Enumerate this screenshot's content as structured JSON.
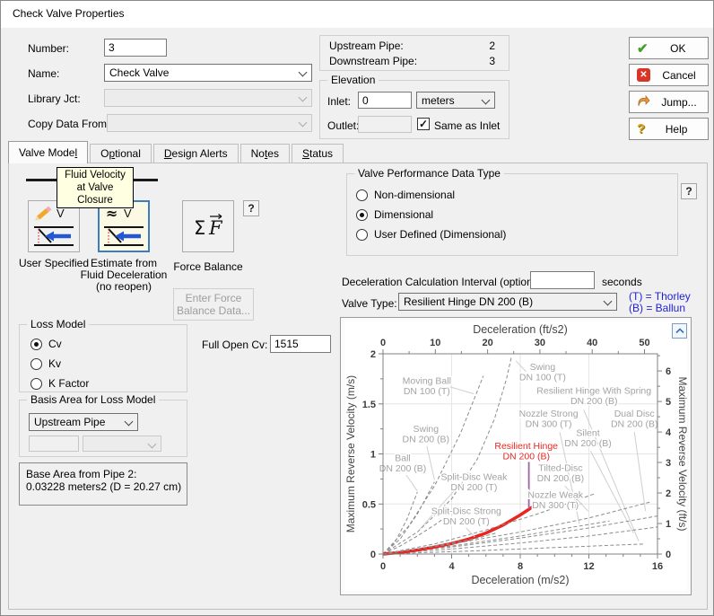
{
  "window": {
    "title": "Check Valve Properties"
  },
  "header": {
    "number_label": "Number:",
    "number_value": "3",
    "name_label": "Name:",
    "name_value": "Check Valve",
    "library_label": "Library Jct:",
    "library_value": "",
    "copy_label": "Copy Data From Jct...",
    "copy_value": "",
    "upstream_label": "Upstream Pipe:",
    "upstream_value": "2",
    "downstream_label": "Downstream Pipe:",
    "downstream_value": "3",
    "elevation": {
      "group_label": "Elevation",
      "inlet_label": "Inlet:",
      "inlet_value": "0",
      "inlet_unit": "meters",
      "outlet_label": "Outlet:",
      "outlet_value": "",
      "same_as_inlet_label": "Same as Inlet",
      "same_as_inlet_checked": true
    }
  },
  "action_buttons": {
    "ok": "OK",
    "cancel": "Cancel",
    "jump": "Jump...",
    "help": "Help"
  },
  "tabs": [
    {
      "label": "Valve Model",
      "accel": 10,
      "active": true
    },
    {
      "label": "Optional",
      "accel": 1
    },
    {
      "label": "Design Alerts",
      "accel": 0
    },
    {
      "label": "Notes",
      "accel": 2
    },
    {
      "label": "Status",
      "accel": 0
    }
  ],
  "valve_model_tab": {
    "tooltip": {
      "line1": "Fluid Velocity",
      "line2": "at Valve Closure"
    },
    "model_buttons": [
      {
        "label_lines": [
          "User Specified"
        ],
        "selected": false
      },
      {
        "label_lines": [
          "Estimate from",
          "Fluid Deceleration",
          "(no reopen)"
        ],
        "selected": true
      },
      {
        "label_lines": [
          "Force Balance"
        ],
        "selected": false
      }
    ],
    "help_button": "?",
    "enter_force_balance_lines": [
      "Enter Force",
      "Balance Data..."
    ],
    "loss_model": {
      "group_label": "Loss Model",
      "options": [
        "Cv",
        "Kv",
        "K Factor"
      ],
      "selected": "Cv"
    },
    "full_open_cv_label": "Full Open Cv:",
    "full_open_cv_value": "1515",
    "basis_area": {
      "group_label": "Basis Area for Loss Model",
      "selected": "Upstream Pipe"
    },
    "base_area_info": {
      "line1": "Base Area from Pipe 2:",
      "line2": "0.03228 meters2 (D = 20.27 cm)"
    },
    "performance": {
      "group_label": "Valve Performance Data Type",
      "options": [
        "Non-dimensional",
        "Dimensional",
        "User Defined (Dimensional)"
      ],
      "selected": "Dimensional",
      "help_button": "?"
    },
    "decel_interval_label": "Deceleration Calculation Interval (optional):",
    "decel_interval_value": "",
    "decel_interval_unit": "seconds",
    "valve_type_label": "Valve Type:",
    "valve_type_value": "Resilient Hinge DN 200 (B)",
    "legend_note": {
      "line1": "(T) = Thorley",
      "line2": "(B) = Ballun"
    }
  },
  "chart_data": {
    "type": "line",
    "xlabel_bottom": "Deceleration (m/s2)",
    "xlabel_top": "Deceleration (ft/s2)",
    "ylabel_left": "Maximum Reverse Velocity (m/s)",
    "ylabel_right": "Maximum Reverse Velocity (ft/s)",
    "xlim": [
      0,
      16
    ],
    "ylim": [
      0,
      2
    ],
    "x_ticks_bottom": [
      0,
      4,
      8,
      12,
      16
    ],
    "x_ticks_top_fts2": [
      0,
      10,
      20,
      30,
      40,
      50
    ],
    "y_ticks_left": [
      0,
      0.5,
      1,
      1.5,
      2
    ],
    "y_ticks_right_fts": [
      0,
      1,
      2,
      3,
      4,
      5,
      6
    ],
    "unit_m_per_ft": 0.3048,
    "grid": true,
    "colors": {
      "curve": "#8c8c8c",
      "label": "#a3a3a3",
      "highlight": "#e8261f",
      "leader": "#cfcfcf",
      "highlight_leader": "#9c64a0",
      "grid": "#e6e6e6",
      "axis": "#808080",
      "tick_text": "#3a3a3a",
      "title_text": "#454545"
    },
    "series": [
      {
        "name": "Moving Ball",
        "variant": "DN 100 (T)",
        "points": [
          [
            0,
            0
          ],
          [
            1.5,
            0.28
          ],
          [
            3,
            0.68
          ],
          [
            4.5,
            1.2
          ],
          [
            5.85,
            1.78
          ]
        ],
        "label": [
          2.55,
          1.7
        ],
        "leader": [
          3.9,
          1.67,
          5.3,
          1.6
        ],
        "highlight": false
      },
      {
        "name": "Swing",
        "variant": "DN 100 (T)",
        "points": [
          [
            0,
            0
          ],
          [
            2,
            0.22
          ],
          [
            4,
            0.55
          ],
          [
            5.5,
            0.95
          ],
          [
            6.5,
            1.35
          ],
          [
            7.2,
            1.75
          ],
          [
            7.5,
            1.98
          ]
        ],
        "label": [
          9.3,
          1.84
        ],
        "leader": [
          8.35,
          1.82,
          7.75,
          1.93
        ],
        "highlight": false
      },
      {
        "name": "Resilient Hinge With Spring",
        "variant": "DN 200 (B)",
        "points": [
          [
            0,
            0
          ],
          [
            5,
            0.03
          ],
          [
            10,
            0.065
          ],
          [
            15.2,
            0.1
          ]
        ],
        "label": [
          12.3,
          1.6
        ],
        "leader": [
          11.7,
          1.44,
          14.9,
          0.13
        ],
        "highlight": false
      },
      {
        "name": "Nozzle Strong",
        "variant": "DN 300 (T)",
        "points": [
          [
            0,
            0
          ],
          [
            4,
            0.08
          ],
          [
            8,
            0.18
          ],
          [
            13.2,
            0.33
          ]
        ],
        "label": [
          9.65,
          1.37
        ],
        "leader": [
          10.3,
          1.22,
          11.45,
          0.3
        ],
        "highlight": false
      },
      {
        "name": "Silent",
        "variant": "DN 200 (B)",
        "points": [
          [
            0,
            0
          ],
          [
            4,
            0.05
          ],
          [
            8,
            0.11
          ],
          [
            12,
            0.18
          ],
          [
            16,
            0.27
          ]
        ],
        "label": [
          11.95,
          1.18
        ],
        "leader": [
          12.1,
          1.03,
          14.6,
          0.21
        ],
        "highlight": false
      },
      {
        "name": "Dual Disc",
        "variant": "DN 200 (B)",
        "points": [
          [
            0,
            0
          ],
          [
            4,
            0.07
          ],
          [
            8,
            0.16
          ],
          [
            12,
            0.26
          ],
          [
            16,
            0.38
          ]
        ],
        "label": [
          14.65,
          1.37
        ],
        "leader": [
          14.65,
          1.22,
          15.3,
          0.43
        ],
        "highlight": false
      },
      {
        "name": "Swing",
        "variant": "DN 200 (B)",
        "points": [
          [
            0,
            0
          ],
          [
            1,
            0.15
          ],
          [
            2,
            0.4
          ],
          [
            3,
            0.72
          ]
        ],
        "label": [
          2.5,
          1.22
        ],
        "leader": [
          2.55,
          1.08,
          3.0,
          0.74
        ],
        "highlight": false
      },
      {
        "name": "Ball",
        "variant": "DN 200 (B)",
        "points": [
          [
            0,
            0
          ],
          [
            0.7,
            0.12
          ],
          [
            1.4,
            0.35
          ],
          [
            2,
            0.62
          ]
        ],
        "label": [
          1.15,
          0.93
        ],
        "leader": [
          1.35,
          0.79,
          2.0,
          0.63
        ],
        "highlight": false
      },
      {
        "name": "Split-Disc Weak",
        "variant": "DN 200 (T)",
        "points": [
          [
            0,
            0
          ],
          [
            1,
            0.08
          ],
          [
            2,
            0.18
          ],
          [
            3,
            0.29
          ],
          [
            3.5,
            0.35
          ]
        ],
        "label": [
          5.3,
          0.74
        ],
        "leader": [
          4.35,
          0.67,
          2.15,
          0.25
        ],
        "highlight": false
      },
      {
        "name": "Resilient Hinge",
        "variant": "DN 200 (B)",
        "points": [
          [
            0,
            0
          ],
          [
            1,
            0.015
          ],
          [
            2,
            0.04
          ],
          [
            3,
            0.07
          ],
          [
            4,
            0.105
          ],
          [
            5,
            0.15
          ],
          [
            6,
            0.21
          ],
          [
            7,
            0.29
          ],
          [
            8,
            0.39
          ],
          [
            8.8,
            0.48
          ]
        ],
        "label": [
          8.35,
          1.05
        ],
        "leader": [
          8.5,
          0.92,
          8.5,
          0.45
        ],
        "highlight": true
      },
      {
        "name": "Tilted-Disc",
        "variant": "DN 200 (B)",
        "points": [
          [
            0,
            0
          ],
          [
            4,
            0.1
          ],
          [
            8,
            0.22
          ],
          [
            12,
            0.36
          ],
          [
            15.6,
            0.52
          ]
        ],
        "label": [
          10.35,
          0.83
        ],
        "leader": [
          10.6,
          0.68,
          11.95,
          0.43
        ],
        "highlight": false
      },
      {
        "name": "Nozzle Weak",
        "variant": "DN 300 (T)",
        "points": [
          [
            0,
            0
          ],
          [
            3,
            0.1
          ],
          [
            6,
            0.24
          ],
          [
            9,
            0.4
          ],
          [
            12.3,
            0.6
          ]
        ],
        "label": [
          10.05,
          0.56
        ],
        "leader": [
          10.9,
          0.43,
          11.6,
          0.51
        ],
        "highlight": false
      },
      {
        "name": "Split-Disc Strong",
        "variant": "DN 200 (T)",
        "points": [
          [
            0,
            0
          ],
          [
            2,
            0.05
          ],
          [
            4,
            0.11
          ],
          [
            5.5,
            0.16
          ],
          [
            6.6,
            0.21
          ]
        ],
        "label": [
          4.85,
          0.4
        ],
        "leader": [
          4.85,
          0.26,
          5.35,
          0.17
        ],
        "highlight": false
      }
    ]
  }
}
